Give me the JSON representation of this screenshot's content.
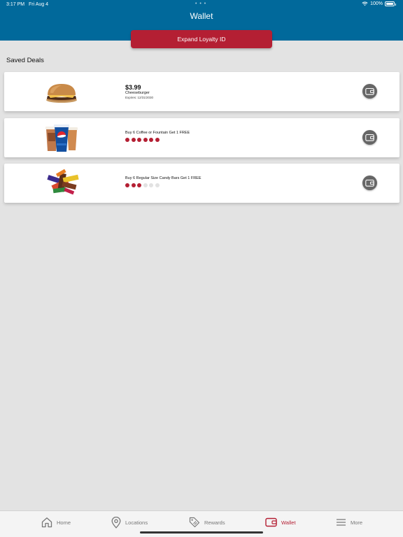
{
  "status_bar": {
    "time": "3:17 PM",
    "date": "Fri Aug 4",
    "multitask_dots": "• • •",
    "battery": "100%"
  },
  "header": {
    "title": "Wallet",
    "background": "#01699b"
  },
  "expand_button": {
    "label": "Expand Loyalty ID",
    "color": "#b41f33"
  },
  "saved_deals": {
    "title": "Saved Deals",
    "deals": [
      {
        "image": "cheeseburger-image",
        "price": "$3.99",
        "name": "Cheeseburger",
        "expires": "Expires: 12/31/2030",
        "action_icon": "wallet-icon"
      },
      {
        "image": "coffee-fountain-drink-image",
        "offer": "Buy 6 Coffee or Fountain Get 1 FREE",
        "punches_filled": 6,
        "punches_total": 6,
        "action_icon": "wallet-icon"
      },
      {
        "image": "candy-bars-image",
        "offer": "Buy 6 Regular Size Candy Bars Get 1 FREE",
        "punches_filled": 3,
        "punches_total": 6,
        "action_icon": "wallet-icon"
      }
    ]
  },
  "tabbar": {
    "active": "Wallet",
    "active_color": "#b41f33",
    "tabs": [
      {
        "label": "Home",
        "icon": "home-icon"
      },
      {
        "label": "Locations",
        "icon": "location-pin-icon"
      },
      {
        "label": "Rewards",
        "icon": "tag-icon"
      },
      {
        "label": "Wallet",
        "icon": "wallet-icon"
      },
      {
        "label": "More",
        "icon": "menu-icon"
      }
    ]
  }
}
